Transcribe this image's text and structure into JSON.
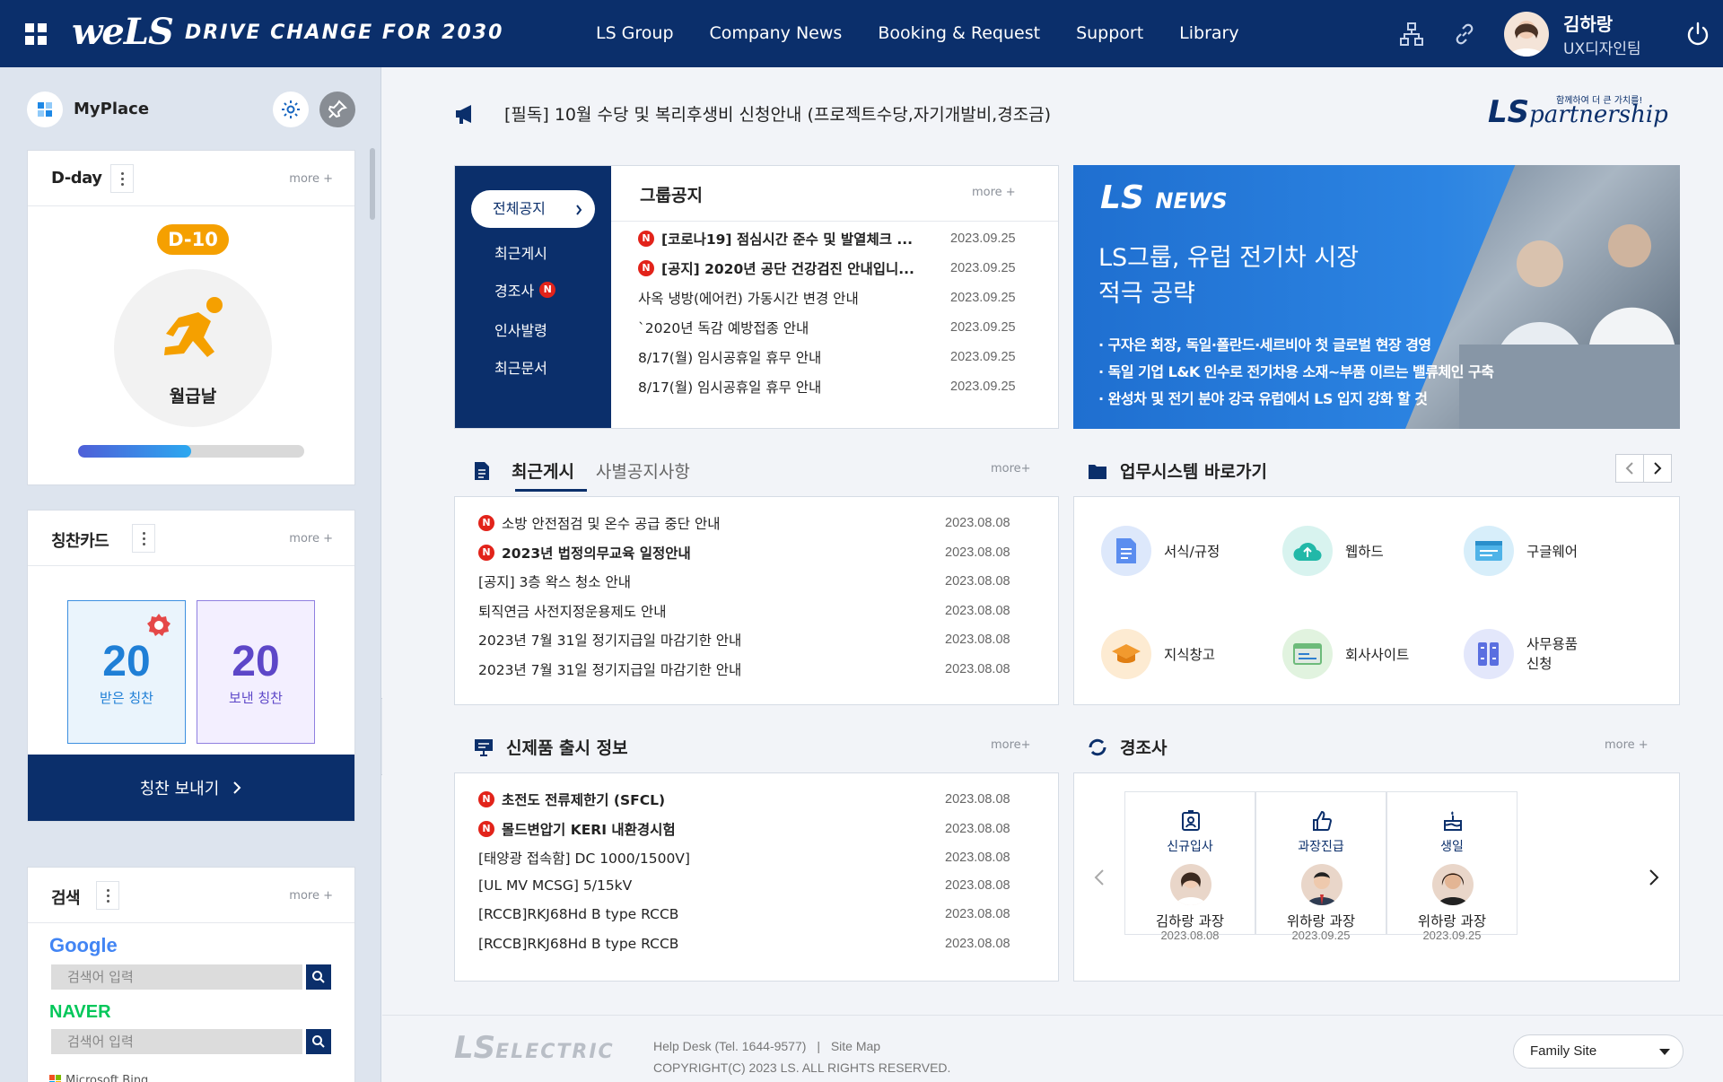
{
  "header": {
    "logo_main": "weLS",
    "slogan": "DRIVE CHANGE FOR 2030",
    "nav": [
      "LS Group",
      "Company News",
      "Booking & Request",
      "Support",
      "Library"
    ],
    "user_name": "김하랑",
    "user_role": "UX디자인팀"
  },
  "sidebar": {
    "title": "MyPlace",
    "dday": {
      "title": "D-day",
      "more": "more +",
      "badge": "D-10",
      "label": "월급날",
      "progress": 0.5
    },
    "praise": {
      "title": "칭찬카드",
      "more": "more +",
      "received_count": "20",
      "received_label": "받은 칭찬",
      "sent_count": "20",
      "sent_label": "보낸 칭찬",
      "send_button": "칭찬 보내기"
    },
    "search": {
      "title": "검색",
      "more": "more +",
      "google": "Google",
      "naver": "NAVER",
      "bing": "Microsoft Bing",
      "placeholder": "검색어 입력"
    }
  },
  "main": {
    "announce": "[필독] 10월 수당 및 복리후생비 신청안내 (프로젝트수당,자기개발비,경조금)",
    "partner_logo": "LS",
    "partner_logo_sub": "partnership",
    "partner_tagline": "함께하여 더 큰 가치를!",
    "notice": {
      "tabs": [
        "전체공지",
        "최근게시",
        "경조사",
        "인사발령",
        "최근문서"
      ],
      "title": "그룹공지",
      "more": "more +",
      "items": [
        {
          "text": "[코로나19] 점심시간 준수 및 발열체크 ...",
          "date": "2023.09.25",
          "new": true
        },
        {
          "text": "[공지] 2020년 공단 건강검진 안내입니...",
          "date": "2023.09.25",
          "new": true
        },
        {
          "text": "사옥 냉방(에어컨) 가동시간 변경 안내",
          "date": "2023.09.25",
          "new": false
        },
        {
          "text": "`2020년 독감 예방접종 안내",
          "date": "2023.09.25",
          "new": false
        },
        {
          "text": "8/17(월) 임시공휴일 휴무 안내",
          "date": "2023.09.25",
          "new": false
        },
        {
          "text": "8/17(월) 임시공휴일 휴무 안내",
          "date": "2023.09.25",
          "new": false
        }
      ]
    },
    "news": {
      "logo": "LS",
      "logo_sub": "NEWS",
      "headline_1": "LS그룹, 유럽 전기차 시장",
      "headline_2": "적극 공략",
      "bullet_1": "· 구자은 회장, 독일·폴란드·세르비아 첫 글로벌 현장 경영",
      "bullet_2": "· 독일 기업 L&K 인수로 전기차용 소재~부품 이르는 밸류체인 구축",
      "bullet_3": "· 완성차 및 전기 분야 강국 유럽에서 LS 입지 강화 할 것"
    },
    "recent": {
      "tab_active": "최근게시",
      "tab_other": "사별공지사항",
      "more": "more+",
      "items": [
        {
          "text": "소방 안전점검 및 온수 공급 중단 안내",
          "date": "2023.08.08",
          "new": true,
          "bold": false
        },
        {
          "text": "2023년 법정의무교육 일정안내",
          "date": "2023.08.08",
          "new": true,
          "bold": true
        },
        {
          "text": "[공지] 3층 왁스 청소 안내",
          "date": "2023.08.08",
          "new": false,
          "bold": false
        },
        {
          "text": "퇴직연금 사전지정운용제도 안내",
          "date": "2023.08.08",
          "new": false,
          "bold": false
        },
        {
          "text": "2023년 7월 31일 정기지급일 마감기한 안내",
          "date": "2023.08.08",
          "new": false,
          "bold": false
        },
        {
          "text": "2023년 7월 31일 정기지급일 마감기한 안내",
          "date": "2023.08.08",
          "new": false,
          "bold": false
        }
      ]
    },
    "systems": {
      "title": "업무시스템 바로가기",
      "items": [
        {
          "label": "서식/규정",
          "label2": ""
        },
        {
          "label": "웹하드",
          "label2": ""
        },
        {
          "label": "구글웨어",
          "label2": ""
        },
        {
          "label": "지식창고",
          "label2": ""
        },
        {
          "label": "회사사이트",
          "label2": ""
        },
        {
          "label": "사무용품",
          "label2": "신청"
        }
      ]
    },
    "products": {
      "title": "신제품 출시 정보",
      "more": "more+",
      "items": [
        {
          "text": "초전도 전류제한기 (SFCL)",
          "date": "2023.08.08",
          "new": true
        },
        {
          "text": "몰드변압기 KERI 내환경시험",
          "date": "2023.08.08",
          "new": true
        },
        {
          "text": "[태양광 접속함] DC 1000/1500V]",
          "date": "2023.08.08",
          "new": false
        },
        {
          "text": "[UL MV MCSG] 5/15kV",
          "date": "2023.08.08",
          "new": false
        },
        {
          "text": "[RCCB]RKJ68Hd B type RCCB",
          "date": "2023.08.08",
          "new": false
        },
        {
          "text": "[RCCB]RKJ68Hd B type RCCB",
          "date": "2023.08.08",
          "new": false
        }
      ]
    },
    "events": {
      "title": "경조사",
      "more": "more +",
      "cards": [
        {
          "type": "신규입사",
          "name": "김하랑 과장",
          "date": "2023.08.08"
        },
        {
          "type": "과장진급",
          "name": "위하랑 과장",
          "date": "2023.09.25"
        },
        {
          "type": "생일",
          "name": "위하랑 과장",
          "date": "2023.09.25"
        }
      ]
    }
  },
  "footer": {
    "logo": "LS",
    "logo_sub": "ELECTRIC",
    "helpdesk": "Help Desk (Tel. 1644-9577)",
    "sep": "|",
    "sitemap": "Site Map",
    "copyright": "COPYRIGHT(C) 2023 LS. ALL RIGHTS RESERVED.",
    "family_site": "Family Site"
  }
}
